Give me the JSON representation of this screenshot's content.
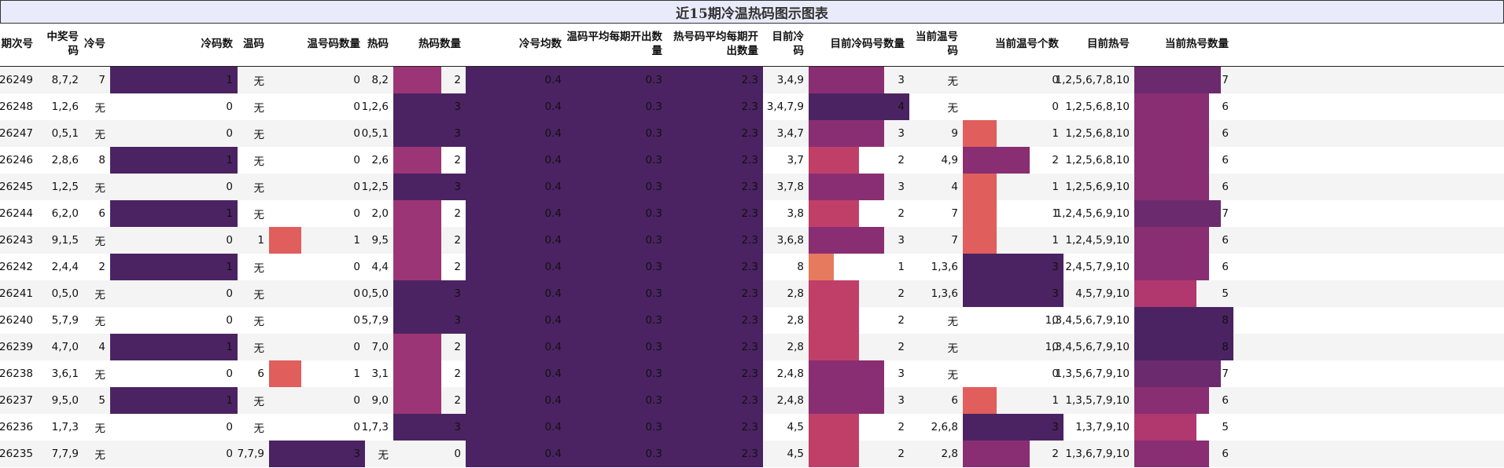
{
  "title": "近15期冷温热码图示图表",
  "columns": [
    {
      "key": "period",
      "label": "期次号"
    },
    {
      "key": "draw",
      "label": "中奖号码"
    },
    {
      "key": "cold",
      "label": "冷号"
    },
    {
      "key": "cold_count",
      "label": "冷码数"
    },
    {
      "key": "warm",
      "label": "温码"
    },
    {
      "key": "warm_count",
      "label": "温号码数量"
    },
    {
      "key": "hot",
      "label": "热码"
    },
    {
      "key": "hot_count",
      "label": "热码数量"
    },
    {
      "key": "cold_avg",
      "label": "冷号均数"
    },
    {
      "key": "warm_avg",
      "label": "温码平均每期开出数量"
    },
    {
      "key": "hot_avg",
      "label": "热号码平均每期开出数量"
    },
    {
      "key": "cur_cold",
      "label": "目前冷码"
    },
    {
      "key": "cur_cold_count",
      "label": "目前冷码号数量"
    },
    {
      "key": "cur_warm",
      "label": "当前温号码"
    },
    {
      "key": "cur_warm_count",
      "label": "当前温号个数"
    },
    {
      "key": "cur_hot",
      "label": "目前热号"
    },
    {
      "key": "cur_hot_count",
      "label": "当前热号数量"
    }
  ],
  "chart_data": {
    "type": "table",
    "title": "近15期冷温热码图示图表",
    "rows": [
      {
        "period": "26249",
        "draw": "8,7,2",
        "cold": "7",
        "cold_count": 1,
        "warm": "无",
        "warm_count": 0,
        "hot": "8,2",
        "hot_count": 2,
        "cold_avg": "0.4",
        "warm_avg": "0.3",
        "hot_avg": "2.3",
        "cur_cold": "3,4,9",
        "cur_cold_count": 3,
        "cur_warm": "无",
        "cur_warm_count": 0,
        "cur_hot": "1,2,5,6,7,8,10",
        "cur_hot_count": 7
      },
      {
        "period": "26248",
        "draw": "1,2,6",
        "cold": "无",
        "cold_count": 0,
        "warm": "无",
        "warm_count": 0,
        "hot": "1,2,6",
        "hot_count": 3,
        "cold_avg": "0.4",
        "warm_avg": "0.3",
        "hot_avg": "2.3",
        "cur_cold": "3,4,7,9",
        "cur_cold_count": 4,
        "cur_warm": "无",
        "cur_warm_count": 0,
        "cur_hot": "1,2,5,6,8,10",
        "cur_hot_count": 6
      },
      {
        "period": "26247",
        "draw": "0,5,1",
        "cold": "无",
        "cold_count": 0,
        "warm": "无",
        "warm_count": 0,
        "hot": "0,5,1",
        "hot_count": 3,
        "cold_avg": "0.4",
        "warm_avg": "0.3",
        "hot_avg": "2.3",
        "cur_cold": "3,4,7",
        "cur_cold_count": 3,
        "cur_warm": "9",
        "cur_warm_count": 1,
        "cur_hot": "1,2,5,6,8,10",
        "cur_hot_count": 6
      },
      {
        "period": "26246",
        "draw": "2,8,6",
        "cold": "8",
        "cold_count": 1,
        "warm": "无",
        "warm_count": 0,
        "hot": "2,6",
        "hot_count": 2,
        "cold_avg": "0.4",
        "warm_avg": "0.3",
        "hot_avg": "2.3",
        "cur_cold": "3,7",
        "cur_cold_count": 2,
        "cur_warm": "4,9",
        "cur_warm_count": 2,
        "cur_hot": "1,2,5,6,8,10",
        "cur_hot_count": 6
      },
      {
        "period": "26245",
        "draw": "1,2,5",
        "cold": "无",
        "cold_count": 0,
        "warm": "无",
        "warm_count": 0,
        "hot": "1,2,5",
        "hot_count": 3,
        "cold_avg": "0.4",
        "warm_avg": "0.3",
        "hot_avg": "2.3",
        "cur_cold": "3,7,8",
        "cur_cold_count": 3,
        "cur_warm": "4",
        "cur_warm_count": 1,
        "cur_hot": "1,2,5,6,9,10",
        "cur_hot_count": 6
      },
      {
        "period": "26244",
        "draw": "6,2,0",
        "cold": "6",
        "cold_count": 1,
        "warm": "无",
        "warm_count": 0,
        "hot": "2,0",
        "hot_count": 2,
        "cold_avg": "0.4",
        "warm_avg": "0.3",
        "hot_avg": "2.3",
        "cur_cold": "3,8",
        "cur_cold_count": 2,
        "cur_warm": "7",
        "cur_warm_count": 1,
        "cur_hot": "1,2,4,5,6,9,10",
        "cur_hot_count": 7
      },
      {
        "period": "26243",
        "draw": "9,1,5",
        "cold": "无",
        "cold_count": 0,
        "warm": "1",
        "warm_count": 1,
        "hot": "9,5",
        "hot_count": 2,
        "cold_avg": "0.4",
        "warm_avg": "0.3",
        "hot_avg": "2.3",
        "cur_cold": "3,6,8",
        "cur_cold_count": 3,
        "cur_warm": "7",
        "cur_warm_count": 1,
        "cur_hot": "1,2,4,5,9,10",
        "cur_hot_count": 6
      },
      {
        "period": "26242",
        "draw": "2,4,4",
        "cold": "2",
        "cold_count": 1,
        "warm": "无",
        "warm_count": 0,
        "hot": "4,4",
        "hot_count": 2,
        "cold_avg": "0.4",
        "warm_avg": "0.3",
        "hot_avg": "2.3",
        "cur_cold": "8",
        "cur_cold_count": 1,
        "cur_warm": "1,3,6",
        "cur_warm_count": 3,
        "cur_hot": "2,4,5,7,9,10",
        "cur_hot_count": 6
      },
      {
        "period": "26241",
        "draw": "0,5,0",
        "cold": "无",
        "cold_count": 0,
        "warm": "无",
        "warm_count": 0,
        "hot": "0,5,0",
        "hot_count": 3,
        "cold_avg": "0.4",
        "warm_avg": "0.3",
        "hot_avg": "2.3",
        "cur_cold": "2,8",
        "cur_cold_count": 2,
        "cur_warm": "1,3,6",
        "cur_warm_count": 3,
        "cur_hot": "4,5,7,9,10",
        "cur_hot_count": 5
      },
      {
        "period": "26240",
        "draw": "5,7,9",
        "cold": "无",
        "cold_count": 0,
        "warm": "无",
        "warm_count": 0,
        "hot": "5,7,9",
        "hot_count": 3,
        "cold_avg": "0.4",
        "warm_avg": "0.3",
        "hot_avg": "2.3",
        "cur_cold": "2,8",
        "cur_cold_count": 2,
        "cur_warm": "无",
        "cur_warm_count": 0,
        "cur_hot": "1,3,4,5,6,7,9,10",
        "cur_hot_count": 8
      },
      {
        "period": "26239",
        "draw": "4,7,0",
        "cold": "4",
        "cold_count": 1,
        "warm": "无",
        "warm_count": 0,
        "hot": "7,0",
        "hot_count": 2,
        "cold_avg": "0.4",
        "warm_avg": "0.3",
        "hot_avg": "2.3",
        "cur_cold": "2,8",
        "cur_cold_count": 2,
        "cur_warm": "无",
        "cur_warm_count": 0,
        "cur_hot": "1,3,4,5,6,7,9,10",
        "cur_hot_count": 8
      },
      {
        "period": "26238",
        "draw": "3,6,1",
        "cold": "无",
        "cold_count": 0,
        "warm": "6",
        "warm_count": 1,
        "hot": "3,1",
        "hot_count": 2,
        "cold_avg": "0.4",
        "warm_avg": "0.3",
        "hot_avg": "2.3",
        "cur_cold": "2,4,8",
        "cur_cold_count": 3,
        "cur_warm": "无",
        "cur_warm_count": 0,
        "cur_hot": "1,3,5,6,7,9,10",
        "cur_hot_count": 7
      },
      {
        "period": "26237",
        "draw": "9,5,0",
        "cold": "5",
        "cold_count": 1,
        "warm": "无",
        "warm_count": 0,
        "hot": "9,0",
        "hot_count": 2,
        "cold_avg": "0.4",
        "warm_avg": "0.3",
        "hot_avg": "2.3",
        "cur_cold": "2,4,8",
        "cur_cold_count": 3,
        "cur_warm": "6",
        "cur_warm_count": 1,
        "cur_hot": "1,3,5,7,9,10",
        "cur_hot_count": 6
      },
      {
        "period": "26236",
        "draw": "1,7,3",
        "cold": "无",
        "cold_count": 0,
        "warm": "无",
        "warm_count": 0,
        "hot": "1,7,3",
        "hot_count": 3,
        "cold_avg": "0.4",
        "warm_avg": "0.3",
        "hot_avg": "2.3",
        "cur_cold": "4,5",
        "cur_cold_count": 2,
        "cur_warm": "2,6,8",
        "cur_warm_count": 3,
        "cur_hot": "1,3,7,9,10",
        "cur_hot_count": 5
      },
      {
        "period": "26235",
        "draw": "7,7,9",
        "cold": "无",
        "cold_count": 0,
        "warm": "7,7,9",
        "warm_count": 3,
        "hot": "无",
        "hot_count": 0,
        "cold_avg": "0.4",
        "warm_avg": "0.3",
        "hot_avg": "2.3",
        "cur_cold": "4,5",
        "cur_cold_count": 2,
        "cur_warm": "2,8",
        "cur_warm_count": 2,
        "cur_hot": "1,3,6,7,9,10",
        "cur_hot_count": 6
      }
    ]
  }
}
